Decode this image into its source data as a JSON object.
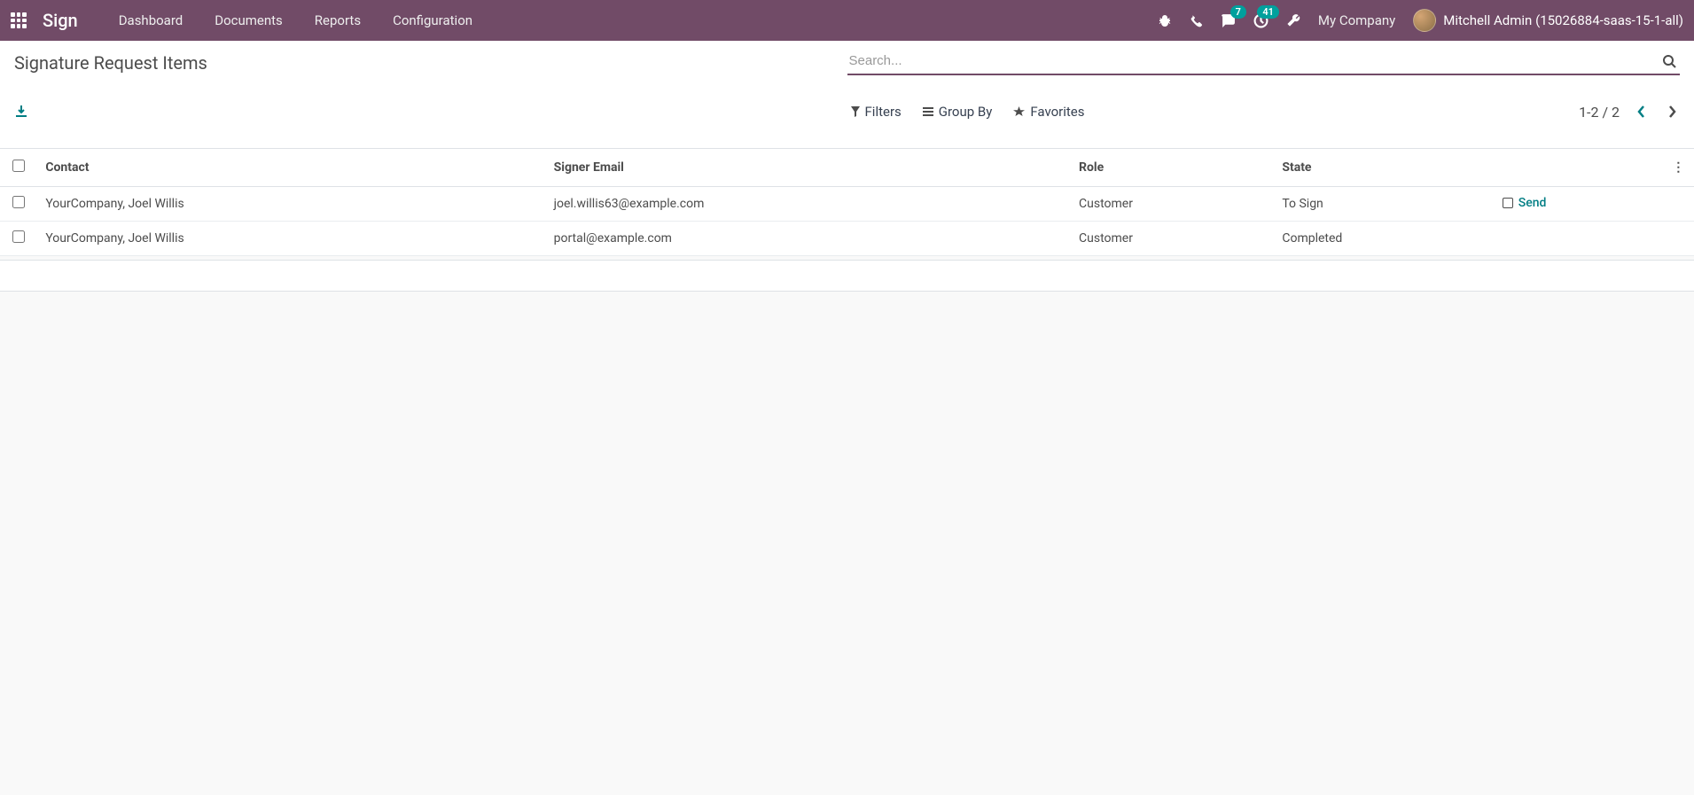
{
  "navbar": {
    "brand": "Sign",
    "menu": [
      "Dashboard",
      "Documents",
      "Reports",
      "Configuration"
    ],
    "messages_badge": "7",
    "activities_badge": "41",
    "company": "My Company",
    "user": "Mitchell Admin (15026884-saas-15-1-all)"
  },
  "control_panel": {
    "title": "Signature Request Items",
    "search_placeholder": "Search...",
    "filters_label": "Filters",
    "groupby_label": "Group By",
    "favorites_label": "Favorites",
    "pager": "1-2 / 2"
  },
  "table": {
    "headers": {
      "contact": "Contact",
      "signer_email": "Signer Email",
      "role": "Role",
      "state": "State"
    },
    "rows": [
      {
        "contact": "YourCompany, Joel Willis",
        "signer_email": "joel.willis63@example.com",
        "role": "Customer",
        "state": "To Sign",
        "action": "Send"
      },
      {
        "contact": "YourCompany, Joel Willis",
        "signer_email": "portal@example.com",
        "role": "Customer",
        "state": "Completed",
        "action": ""
      }
    ]
  }
}
